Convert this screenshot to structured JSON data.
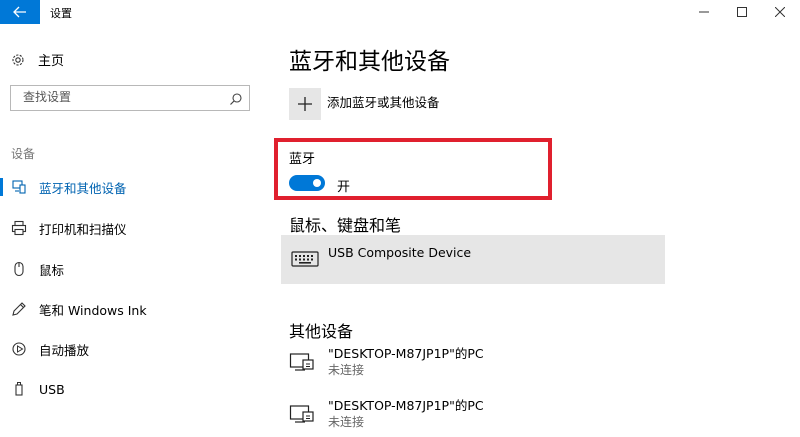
{
  "titlebar": {
    "title": "设置",
    "back_icon": "arrow-left-icon",
    "minimize_icon": "minimize-icon",
    "maximize_icon": "maximize-icon",
    "close_icon": "close-icon",
    "accent_color": "#0078d7"
  },
  "sidebar": {
    "home_label": "主页",
    "search_placeholder": "查找设置",
    "section_label": "设备",
    "items": [
      {
        "label": "蓝牙和其他设备",
        "icon": "bluetooth-devices-icon",
        "active": true
      },
      {
        "label": "打印机和扫描仪",
        "icon": "printer-icon",
        "active": false
      },
      {
        "label": "鼠标",
        "icon": "mouse-icon",
        "active": false
      },
      {
        "label": "笔和 Windows Ink",
        "icon": "pen-icon",
        "active": false
      },
      {
        "label": "自动播放",
        "icon": "autoplay-icon",
        "active": false
      },
      {
        "label": "USB",
        "icon": "usb-icon",
        "active": false
      }
    ]
  },
  "main": {
    "title": "蓝牙和其他设备",
    "add_device_label": "添加蓝牙或其他设备",
    "bluetooth": {
      "label": "蓝牙",
      "state_label": "开",
      "on": true
    },
    "mouse_section": {
      "heading": "鼠标、键盘和笔",
      "devices": [
        {
          "name": "USB Composite Device",
          "icon": "keyboard-icon"
        }
      ]
    },
    "other_section": {
      "heading": "其他设备",
      "devices": [
        {
          "name": "\"DESKTOP-M87JP1P\"的PC",
          "status": "未连接",
          "icon": "pc-device-icon"
        },
        {
          "name": "\"DESKTOP-M87JP1P\"的PC",
          "status": "未连接",
          "icon": "pc-device-icon"
        }
      ]
    }
  },
  "highlight_color": "#e0202e"
}
